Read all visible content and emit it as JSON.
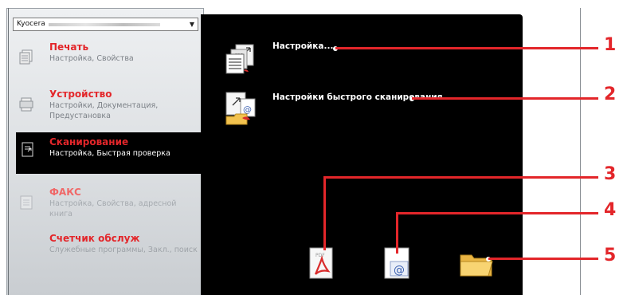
{
  "device_dropdown": {
    "value": "Kyocera"
  },
  "sidebar": {
    "items": [
      {
        "title": "Печать",
        "subtitle": "Настройка, Свойства"
      },
      {
        "title": "Устройство",
        "subtitle": "Настройки, Документация, Предустановка"
      },
      {
        "title": "Сканирование",
        "subtitle": "Настройка, Быстрая проверка"
      },
      {
        "title": "ФАКС",
        "subtitle": "Настройка, Свойства, адресной книга"
      },
      {
        "title": "Счетчик обслуж",
        "subtitle": "Служебные программы, Закл., поиск"
      }
    ]
  },
  "scan_panel": {
    "settings_label": "Настройка...",
    "quick_scan_label": "Настройки быстрого сканирования..."
  },
  "callouts": [
    "1",
    "2",
    "3",
    "4",
    "5"
  ],
  "colors": {
    "accent": "#e3262a",
    "panel": "#000000"
  },
  "icons": [
    "print-icon",
    "device-icon",
    "scan-icon",
    "fax-icon",
    "counter-icon",
    "scan-settings-icon",
    "quick-scan-settings-icon",
    "scan-to-pdf-icon",
    "scan-to-email-icon",
    "scan-to-folder-icon"
  ]
}
